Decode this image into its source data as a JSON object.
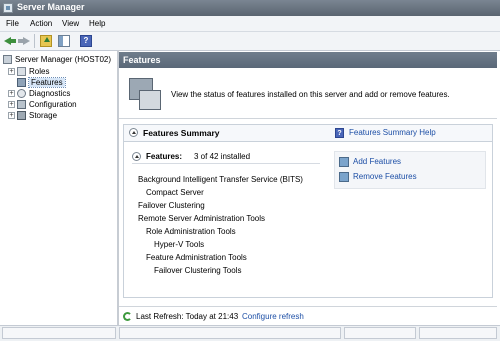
{
  "window": {
    "title": "Server Manager"
  },
  "menu": [
    "File",
    "Action",
    "View",
    "Help"
  ],
  "toolbar": {
    "help_glyph": "?"
  },
  "tree": {
    "root": "Server Manager (HOST02)",
    "items": [
      {
        "label": "Roles",
        "icon": "roles-icon",
        "expander": "+"
      },
      {
        "label": "Features",
        "icon": "features-icon",
        "selected": true,
        "expander": ""
      },
      {
        "label": "Diagnostics",
        "icon": "diagnostics-icon",
        "expander": "+"
      },
      {
        "label": "Configuration",
        "icon": "configuration-icon",
        "expander": "+"
      },
      {
        "label": "Storage",
        "icon": "storage-icon",
        "expander": "+"
      }
    ]
  },
  "content": {
    "header": "Features",
    "intro": "View the status of features installed on this server and add or remove features.",
    "summary": {
      "title": "Features Summary",
      "help_link": "Features Summary Help",
      "features_label": "Features:",
      "features_count": "3 of 42 installed",
      "installed": [
        {
          "label": "Background Intelligent Transfer Service (BITS)",
          "level": 0
        },
        {
          "label": "Compact Server",
          "level": 1
        },
        {
          "label": "Failover Clustering",
          "level": 0
        },
        {
          "label": "Remote Server Administration Tools",
          "level": 0
        },
        {
          "label": "Role Administration Tools",
          "level": 1
        },
        {
          "label": "Hyper-V Tools",
          "level": 2
        },
        {
          "label": "Feature Administration Tools",
          "level": 1
        },
        {
          "label": "Failover Clustering Tools",
          "level": 2
        }
      ],
      "actions": [
        "Add Features",
        "Remove Features"
      ]
    },
    "refresh": {
      "text": "Last Refresh: Today at 21:43",
      "link": "Configure refresh"
    }
  },
  "colors": {
    "link": "#1d4fa6",
    "header": "#5a6878",
    "selection": "#d7e6f7"
  }
}
